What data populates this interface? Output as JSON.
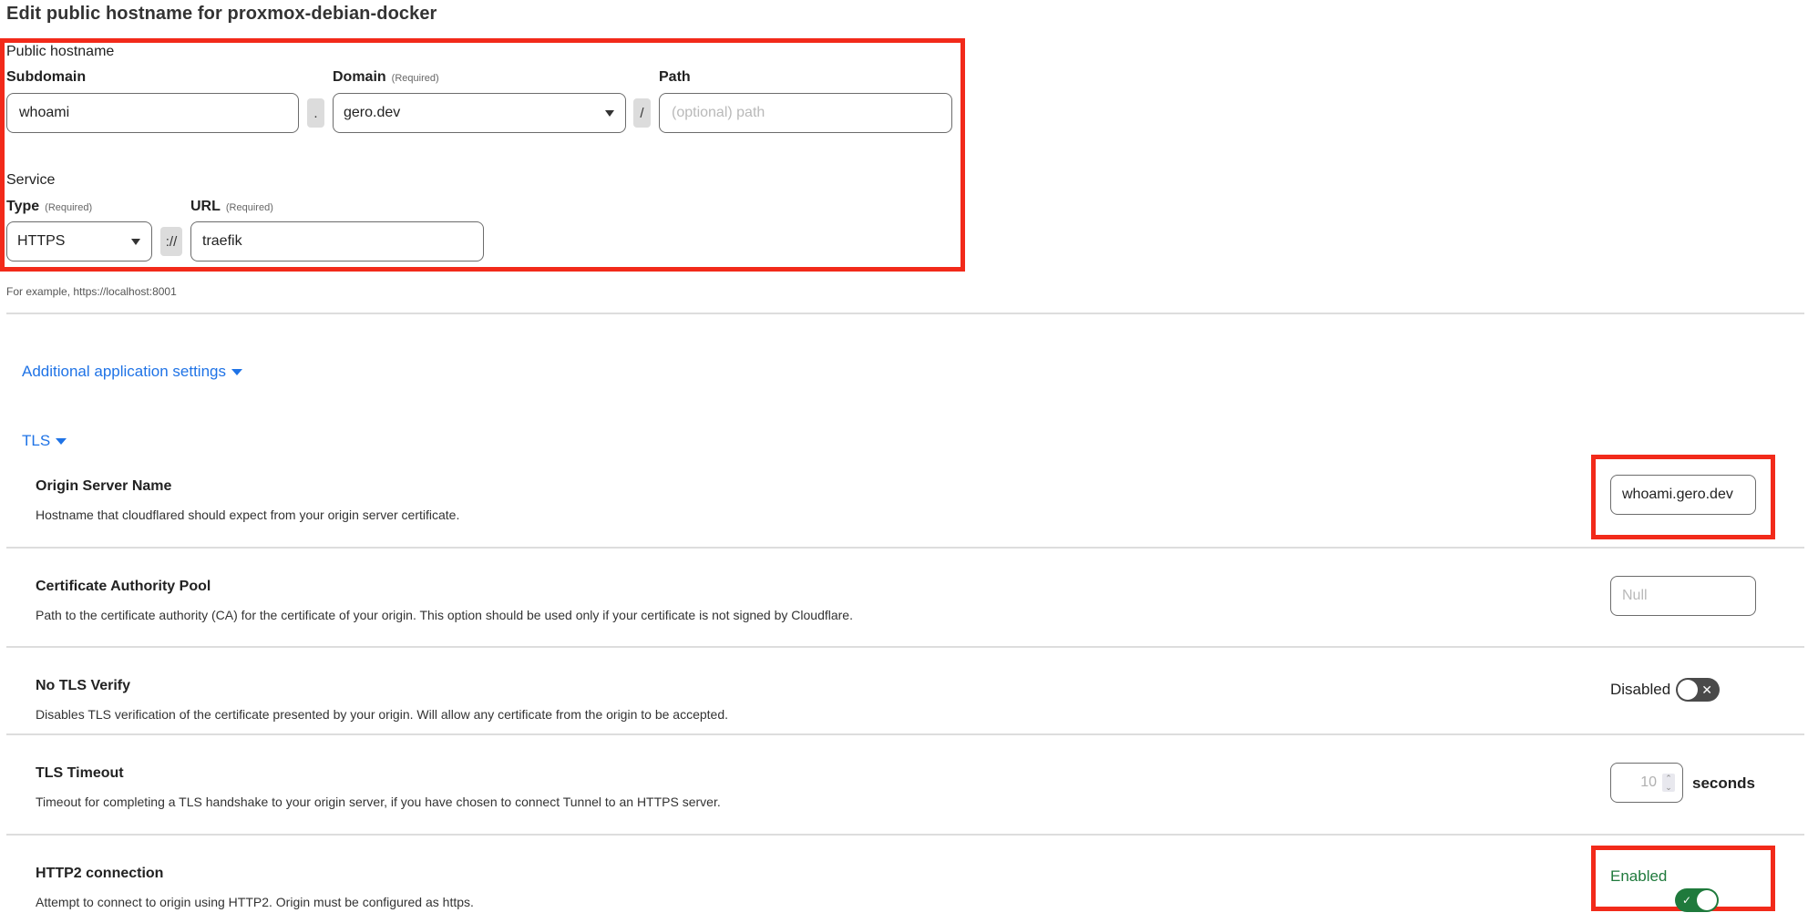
{
  "page": {
    "title": "Edit public hostname for proxmox-debian-docker"
  },
  "public_hostname": {
    "section_label": "Public hostname",
    "subdomain": {
      "label": "Subdomain",
      "value": "whoami"
    },
    "dot_separator": ".",
    "domain": {
      "label": "Domain",
      "required": "(Required)",
      "value": "gero.dev"
    },
    "slash_separator": "/",
    "path": {
      "label": "Path",
      "placeholder": "(optional) path",
      "value": ""
    }
  },
  "service": {
    "section_label": "Service",
    "type": {
      "label": "Type",
      "required": "(Required)",
      "value": "HTTPS"
    },
    "scheme_separator": "://",
    "url": {
      "label": "URL",
      "required": "(Required)",
      "value": "traefik"
    },
    "hint": "For example, https://localhost:8001"
  },
  "additional_settings": {
    "toggle_label": "Additional application settings"
  },
  "tls": {
    "toggle_label": "TLS",
    "rows": [
      {
        "title": "Origin Server Name",
        "description": "Hostname that cloudflared should expect from your origin server certificate.",
        "value": "whoami.gero.dev"
      },
      {
        "title": "Certificate Authority Pool",
        "description": "Path to the certificate authority (CA) for the certificate of your origin. This option should be used only if your certificate is not signed by Cloudflare.",
        "placeholder": "Null",
        "value": ""
      },
      {
        "title": "No TLS Verify",
        "description": "Disables TLS verification of the certificate presented by your origin. Will allow any certificate from the origin to be accepted.",
        "state_label": "Disabled",
        "enabled": false
      },
      {
        "title": "TLS Timeout",
        "description": "Timeout for completing a TLS handshake to your origin server, if you have chosen to connect Tunnel to an HTTPS server.",
        "value": "10",
        "unit": "seconds"
      },
      {
        "title": "HTTP2 connection",
        "description": "Attempt to connect to origin using HTTP2. Origin must be configured as https.",
        "state_label": "Enabled",
        "enabled": true
      }
    ]
  },
  "colors": {
    "highlight": "#f22a1a",
    "link": "#1f73e6",
    "toggle_on": "#1f7a3c",
    "toggle_off": "#4a4a4a",
    "enabled_text": "#1f7a3c"
  }
}
